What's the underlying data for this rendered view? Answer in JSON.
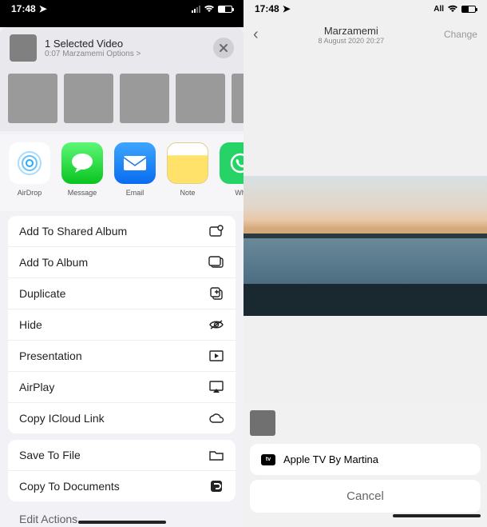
{
  "left": {
    "status": {
      "time": "17:48"
    },
    "header": {
      "title": "1 Selected Video",
      "subtitle": "0:07 Marzamemi Options >"
    },
    "apps": [
      {
        "label": "AirDrop"
      },
      {
        "label": "Message"
      },
      {
        "label": "Email"
      },
      {
        "label": "Note"
      },
      {
        "label": "Wh"
      }
    ],
    "group1": [
      {
        "label": "Add To Shared Album"
      },
      {
        "label": "Add To Album"
      },
      {
        "label": "Duplicate"
      },
      {
        "label": "Hide"
      },
      {
        "label": "Presentation"
      },
      {
        "label": "AirPlay"
      },
      {
        "label": "Copy ICloud Link"
      }
    ],
    "group2": [
      {
        "label": "Save To File"
      },
      {
        "label": "Copy To Documents"
      }
    ],
    "edit": "Edit Actions....."
  },
  "right": {
    "status": {
      "time": "17:48",
      "carrier": "All"
    },
    "nav": {
      "title": "Marzamemi",
      "subtitle": "8 August 2020 20:27",
      "change": "Change"
    },
    "airplay": {
      "device": "Apple TV By Martina"
    },
    "cancel": "Cancel"
  }
}
